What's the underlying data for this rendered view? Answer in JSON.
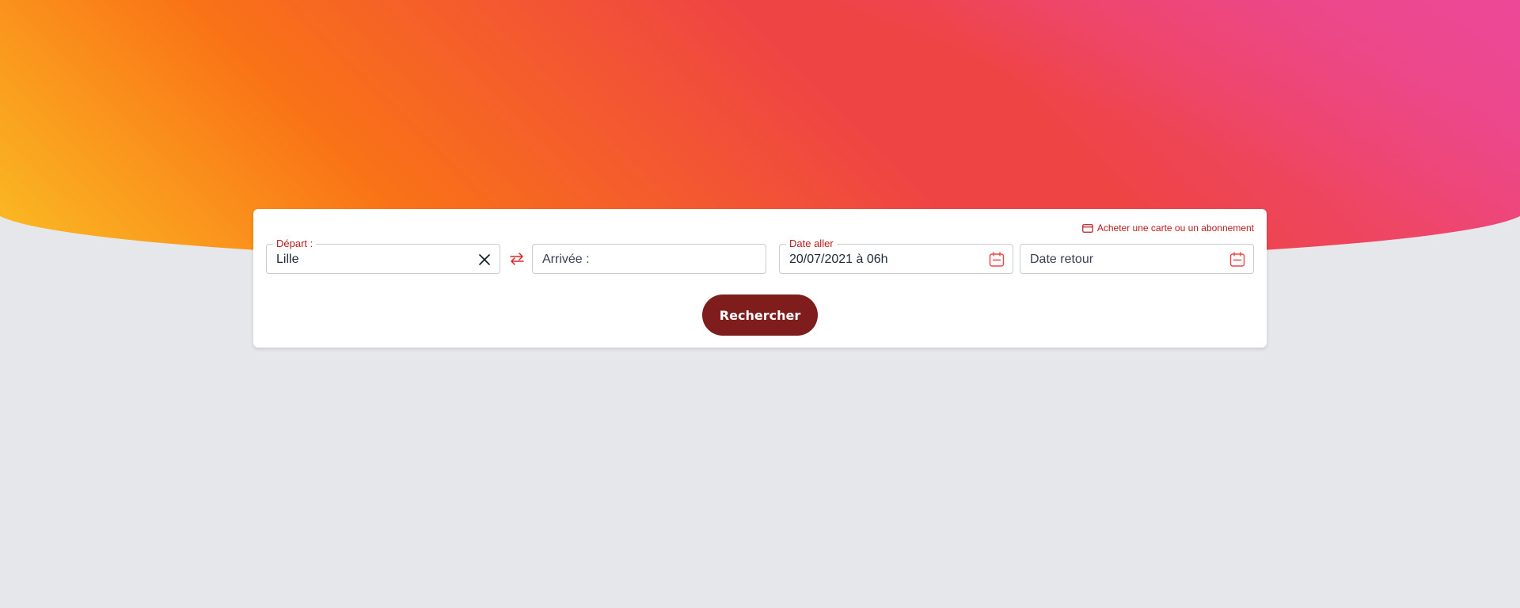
{
  "colors": {
    "accent": "#b91c1c",
    "button": "#7f1d1d",
    "background": "#e5e7eb",
    "gradient": [
      "#ec4899",
      "#ef4444",
      "#f97316",
      "#fbbf24"
    ]
  },
  "header": {
    "buy_link_label": "Acheter une carte ou un abonnement",
    "buy_link_icon": "credit-card-icon"
  },
  "form": {
    "departure": {
      "legend": "Départ :",
      "value": "Lille",
      "clear_icon": "close-icon"
    },
    "swap_icon": "swap-arrows-icon",
    "arrival": {
      "placeholder": "Arrivée :"
    },
    "date_out": {
      "legend": "Date aller",
      "value": "20/07/2021 à 06h",
      "icon": "calendar-icon"
    },
    "date_return": {
      "placeholder": "Date retour",
      "icon": "calendar-icon"
    },
    "search_label": "Rechercher"
  }
}
